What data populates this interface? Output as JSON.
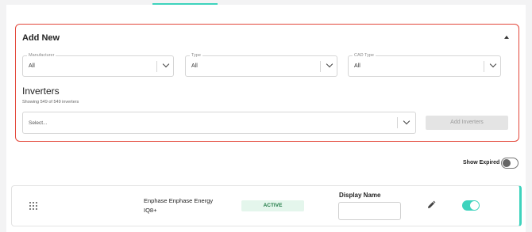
{
  "add_new": {
    "title": "Add New",
    "filters": [
      {
        "legend": "Manufacturer",
        "value": "All"
      },
      {
        "legend": "Type",
        "value": "All"
      },
      {
        "legend": "CAD Type",
        "value": "All"
      }
    ],
    "section_title": "Inverters",
    "showing_text": "Showing 549 of 549 inverters",
    "select_placeholder": "Select...",
    "add_button_label": "Add Inverters"
  },
  "show_expired": {
    "label": "Show Expired",
    "enabled": false
  },
  "inverters": [
    {
      "name": "Enphase Enphase Energy IQ8+",
      "status": "ACTIVE",
      "display_name_label": "Display Name",
      "display_name_value": "",
      "enabled": true
    }
  ],
  "colors": {
    "accent": "#3ed3bd",
    "panel_border": "#e3473a",
    "active_badge_bg": "#e4f6ec",
    "active_badge_text": "#1f7a45"
  },
  "icons": {
    "drag": "drag-handle-icon",
    "edit": "pencil-icon",
    "dropdown": "chevron-down-icon",
    "collapse": "caret-up-icon"
  }
}
